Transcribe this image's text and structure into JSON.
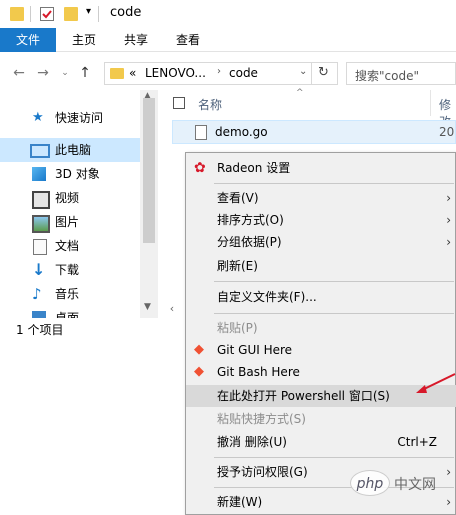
{
  "window": {
    "title": "code"
  },
  "ribbon": {
    "tabs": [
      "文件",
      "主页",
      "共享",
      "查看"
    ]
  },
  "address": {
    "path": [
      "«",
      "LENOVO...",
      "code"
    ],
    "search_placeholder": "搜索\"code\""
  },
  "nav": {
    "items": [
      {
        "label": "快速访问",
        "icon": "star-icon"
      },
      {
        "label": "此电脑",
        "icon": "computer-icon"
      },
      {
        "label": "3D 对象",
        "icon": "cube-icon"
      },
      {
        "label": "视频",
        "icon": "video-icon"
      },
      {
        "label": "图片",
        "icon": "picture-icon"
      },
      {
        "label": "文档",
        "icon": "document-icon"
      },
      {
        "label": "下载",
        "icon": "download-icon"
      },
      {
        "label": "音乐",
        "icon": "music-icon"
      },
      {
        "label": "桌面",
        "icon": "desktop-icon"
      }
    ]
  },
  "files": {
    "columns": [
      "名称",
      "修改"
    ],
    "items": [
      {
        "name": "demo.go",
        "date": "20"
      }
    ]
  },
  "status": {
    "count": "1 个项目"
  },
  "context_menu": {
    "items": [
      {
        "label": "Radeon 设置"
      },
      {
        "label": "查看(V)"
      },
      {
        "label": "排序方式(O)"
      },
      {
        "label": "分组依据(P)"
      },
      {
        "label": "刷新(E)"
      },
      {
        "label": "自定义文件夹(F)..."
      },
      {
        "label": "粘贴(P)"
      },
      {
        "label": "Git GUI Here"
      },
      {
        "label": "Git Bash Here"
      },
      {
        "label": "在此处打开 Powershell 窗口(S)"
      },
      {
        "label": "粘贴快捷方式(S)"
      },
      {
        "label": "撤消 删除(U)",
        "shortcut": "Ctrl+Z"
      },
      {
        "label": "授予访问权限(G)"
      },
      {
        "label": "新建(W)"
      }
    ]
  },
  "watermark": {
    "text": "php",
    "subtext": "中文网"
  },
  "colors": {
    "accent": "#1979ca",
    "arrow": "#d7192a",
    "menu_bg": "#f0f0f0",
    "selected": "#cce8ff"
  }
}
